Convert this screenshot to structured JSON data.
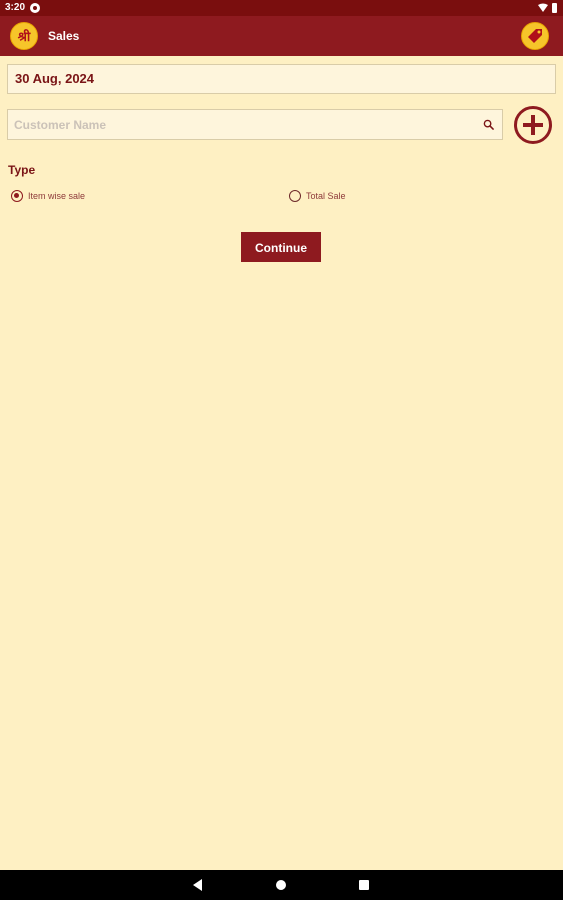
{
  "status_bar": {
    "time": "3:20",
    "icons": [
      "g-icon",
      "wifi-icon",
      "battery-icon"
    ]
  },
  "app_bar": {
    "logo_text": "श्री",
    "title": "Sales",
    "action_icon": "tag-icon"
  },
  "date_field": {
    "value": "30 Aug, 2024"
  },
  "customer_search": {
    "placeholder": "Customer Name",
    "value": "",
    "icon": "search-icon"
  },
  "add_button": {
    "icon": "plus-circle-icon"
  },
  "type_section": {
    "label": "Type",
    "options": [
      {
        "label": "Item wise sale",
        "selected": true
      },
      {
        "label": "Total Sale",
        "selected": false
      }
    ]
  },
  "continue_button": {
    "label": "Continue"
  },
  "nav_bar": {
    "icons": [
      "back-icon",
      "home-icon",
      "recents-icon"
    ]
  },
  "colors": {
    "primary": "#8E1A1F",
    "status_bar": "#7A0E0E",
    "background": "#FEF0C3",
    "field_background": "#FEF5DC",
    "accent_yellow": "#F6C52A"
  }
}
